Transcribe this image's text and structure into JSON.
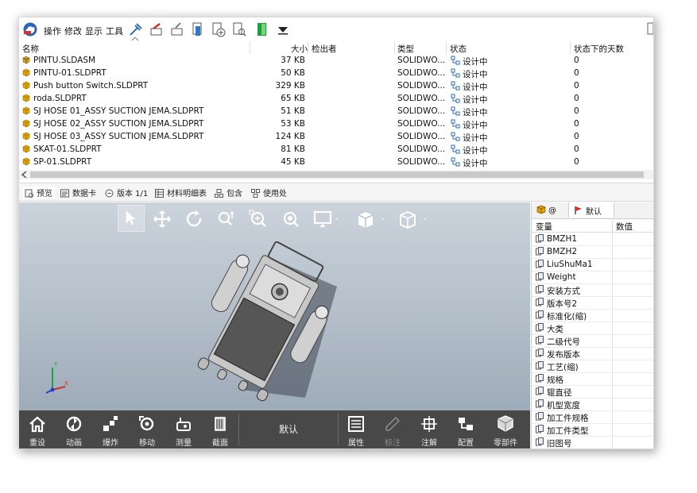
{
  "toolbar": {
    "menus": [
      "操作",
      "修改",
      "显示",
      "工具"
    ]
  },
  "file_list": {
    "columns": [
      "名称",
      "大小",
      "检出者",
      "类型",
      "状态",
      "状态下的天数"
    ],
    "rows": [
      {
        "name": "PINTU.SLDASM",
        "size": "37 KB",
        "checked_out_by": "",
        "type": "SOLIDWO...",
        "state": "设计中",
        "days": "0"
      },
      {
        "name": "PINTU-01.SLDPRT",
        "size": "50 KB",
        "checked_out_by": "",
        "type": "SOLIDWO...",
        "state": "设计中",
        "days": "0"
      },
      {
        "name": "Push button Switch.SLDPRT",
        "size": "329 KB",
        "checked_out_by": "",
        "type": "SOLIDWO...",
        "state": "设计中",
        "days": "0"
      },
      {
        "name": "roda.SLDPRT",
        "size": "65 KB",
        "checked_out_by": "",
        "type": "SOLIDWO...",
        "state": "设计中",
        "days": "0"
      },
      {
        "name": "SJ HOSE 01_ASSY SUCTION JEMA.SLDPRT",
        "size": "51 KB",
        "checked_out_by": "",
        "type": "SOLIDWO...",
        "state": "设计中",
        "days": "0"
      },
      {
        "name": "SJ HOSE 02_ASSY SUCTION JEMA.SLDPRT",
        "size": "53 KB",
        "checked_out_by": "",
        "type": "SOLIDWO...",
        "state": "设计中",
        "days": "0"
      },
      {
        "name": "SJ HOSE 03_ASSY SUCTION JEMA.SLDPRT",
        "size": "124 KB",
        "checked_out_by": "",
        "type": "SOLIDWO...",
        "state": "设计中",
        "days": "0"
      },
      {
        "name": "SKAT-01.SLDPRT",
        "size": "81 KB",
        "checked_out_by": "",
        "type": "SOLIDWO...",
        "state": "设计中",
        "days": "0"
      },
      {
        "name": "SP-01.SLDPRT",
        "size": "45 KB",
        "checked_out_by": "",
        "type": "SOLIDWO...",
        "state": "设计中",
        "days": "0"
      }
    ]
  },
  "tabs": [
    {
      "label": "预览",
      "icon": "preview-icon"
    },
    {
      "label": "数据卡",
      "icon": "datacard-icon"
    },
    {
      "label": "版本 1/1",
      "icon": "version-icon"
    },
    {
      "label": "材料明细表",
      "icon": "bom-icon"
    },
    {
      "label": "包含",
      "icon": "contains-icon"
    },
    {
      "label": "使用处",
      "icon": "where-used-icon"
    }
  ],
  "bottom_bar": {
    "left_buttons": [
      {
        "label": "重设",
        "icon": "home-icon"
      },
      {
        "label": "动画",
        "icon": "animate-icon"
      },
      {
        "label": "爆炸",
        "icon": "explode-icon"
      },
      {
        "label": "移动",
        "icon": "move-icon"
      },
      {
        "label": "测量",
        "icon": "measure-icon"
      },
      {
        "label": "截面",
        "icon": "section-icon"
      }
    ],
    "config_name": "默认",
    "right_buttons": [
      {
        "label": "属性",
        "icon": "properties-icon"
      },
      {
        "label": "标注",
        "icon": "markup-icon"
      },
      {
        "label": "注解",
        "icon": "annotation-icon"
      },
      {
        "label": "配置",
        "icon": "configuration-icon"
      },
      {
        "label": "零部件",
        "icon": "components-icon"
      }
    ]
  },
  "right_panel": {
    "tabs": {
      "first": "@",
      "second": "默认"
    },
    "columns": [
      "变量",
      "数值"
    ],
    "variables": [
      "BMZH1",
      "BMZH2",
      "LiuShuMa1",
      "Weight",
      "安装方式",
      "版本号2",
      "标准化(缩)",
      "大类",
      "二级代号",
      "发布版本",
      "工艺(缩)",
      "规格",
      "辊直径",
      "机型宽度",
      "加工件规格",
      "加工件类型",
      "旧图号"
    ]
  },
  "colors": {
    "viewport_top": "#cbd3db",
    "viewport_bottom": "#9eabb8",
    "bottom_bar": "#484848",
    "state_icon": "#2f6fb5",
    "file_icon": "#e0a400"
  }
}
